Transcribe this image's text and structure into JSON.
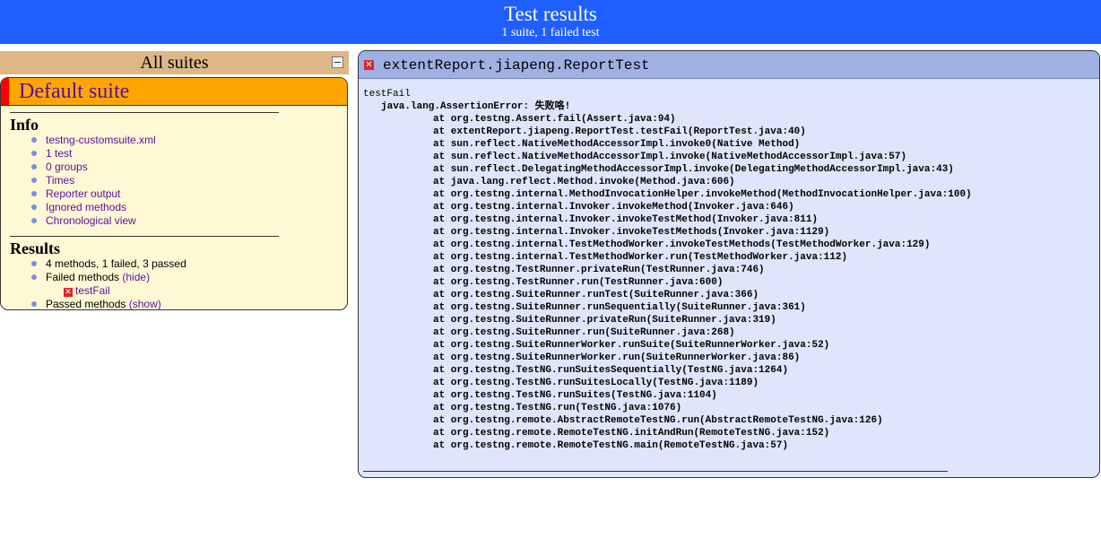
{
  "header": {
    "title": "Test results",
    "subtitle": "1 suite, 1 failed test"
  },
  "sidebar": {
    "all_suites_label": "All suites",
    "suite_name": "Default suite",
    "info": {
      "heading": "Info",
      "items": [
        "testng-customsuite.xml",
        "1 test",
        "0 groups",
        "Times",
        "Reporter output",
        "Ignored methods",
        "Chronological view"
      ]
    },
    "results": {
      "heading": "Results",
      "summary": "4 methods, 1 failed, 3 passed",
      "failed_label": "Failed methods",
      "failed_toggle": "(hide)",
      "failed_item": "testFail",
      "passed_label": "Passed methods",
      "passed_toggle": "(show)"
    }
  },
  "detail": {
    "class_name": "extentReport.jiapeng.ReportTest",
    "test_name": "testFail",
    "exception": "java.lang.AssertionError: 失败咯!",
    "stack": [
      "at org.testng.Assert.fail(Assert.java:94)",
      "at extentReport.jiapeng.ReportTest.testFail(ReportTest.java:40)",
      "at sun.reflect.NativeMethodAccessorImpl.invoke0(Native Method)",
      "at sun.reflect.NativeMethodAccessorImpl.invoke(NativeMethodAccessorImpl.java:57)",
      "at sun.reflect.DelegatingMethodAccessorImpl.invoke(DelegatingMethodAccessorImpl.java:43)",
      "at java.lang.reflect.Method.invoke(Method.java:606)",
      "at org.testng.internal.MethodInvocationHelper.invokeMethod(MethodInvocationHelper.java:100)",
      "at org.testng.internal.Invoker.invokeMethod(Invoker.java:646)",
      "at org.testng.internal.Invoker.invokeTestMethod(Invoker.java:811)",
      "at org.testng.internal.Invoker.invokeTestMethods(Invoker.java:1129)",
      "at org.testng.internal.TestMethodWorker.invokeTestMethods(TestMethodWorker.java:129)",
      "at org.testng.internal.TestMethodWorker.run(TestMethodWorker.java:112)",
      "at org.testng.TestRunner.privateRun(TestRunner.java:746)",
      "at org.testng.TestRunner.run(TestRunner.java:600)",
      "at org.testng.SuiteRunner.runTest(SuiteRunner.java:366)",
      "at org.testng.SuiteRunner.runSequentially(SuiteRunner.java:361)",
      "at org.testng.SuiteRunner.privateRun(SuiteRunner.java:319)",
      "at org.testng.SuiteRunner.run(SuiteRunner.java:268)",
      "at org.testng.SuiteRunnerWorker.runSuite(SuiteRunnerWorker.java:52)",
      "at org.testng.SuiteRunnerWorker.run(SuiteRunnerWorker.java:86)",
      "at org.testng.TestNG.runSuitesSequentially(TestNG.java:1264)",
      "at org.testng.TestNG.runSuitesLocally(TestNG.java:1189)",
      "at org.testng.TestNG.runSuites(TestNG.java:1104)",
      "at org.testng.TestNG.run(TestNG.java:1076)",
      "at org.testng.remote.AbstractRemoteTestNG.run(AbstractRemoteTestNG.java:126)",
      "at org.testng.remote.RemoteTestNG.initAndRun(RemoteTestNG.java:152)",
      "at org.testng.remote.RemoteTestNG.main(RemoteTestNG.java:57)"
    ]
  },
  "icons": {
    "collapse": "collapse-icon",
    "fail": "fail-x-icon",
    "bullet": "bullet-icon"
  },
  "colors": {
    "header_bg": "#1f5eff",
    "suite_header_bg": "#ffa500",
    "all_suites_bg": "#ddb886",
    "panel_bg": "#dfe6fb",
    "fail_red": "#e0242f"
  }
}
